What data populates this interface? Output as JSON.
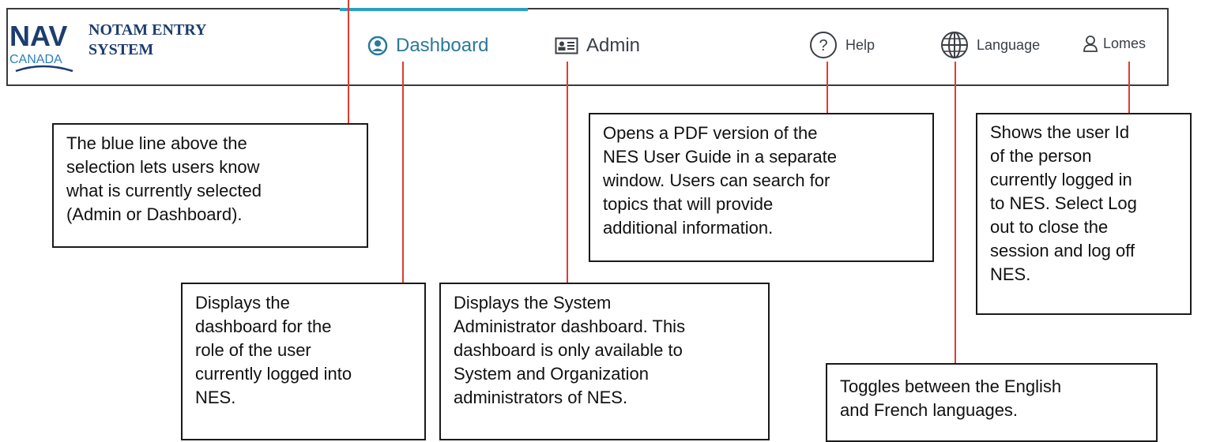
{
  "header": {
    "logo": {
      "brand_top": "NAV",
      "brand_bottom": "CANADA"
    },
    "app_title_line1": "NOTAM ENTRY",
    "app_title_line2": "SYSTEM",
    "nav": {
      "dashboard": "Dashboard",
      "admin": "Admin",
      "help": "Help",
      "language": "Language",
      "user": "Lomes"
    },
    "selected_tab": "Dashboard",
    "selection_indicator_color": "#2a9ec6"
  },
  "callouts": {
    "selection_line": [
      "The blue line above the",
      "selection lets users know",
      "what is currently selected",
      "(Admin or Dashboard)."
    ],
    "help": [
      "Opens a PDF version of the",
      "NES User Guide in a separate",
      "window. Users can search for",
      "topics that will provide",
      "additional information."
    ],
    "user": [
      "Shows the user Id",
      "of the person",
      "currently logged in",
      "to NES. Select Log",
      "out to close the",
      "session and log off",
      "NES."
    ],
    "dashboard": [
      "Displays the",
      "dashboard for the",
      "role of the user",
      "currently logged into",
      "NES."
    ],
    "admin": [
      "Displays the System",
      "Administrator dashboard. This",
      "dashboard is only available to",
      "System and Organization",
      "administrators of NES."
    ],
    "language": [
      "Toggles between the English",
      "and French languages."
    ]
  },
  "colors": {
    "leader_line": "#e23b2f",
    "brand_navy": "#1c3d6e",
    "brand_blue": "#2a7fbf"
  }
}
